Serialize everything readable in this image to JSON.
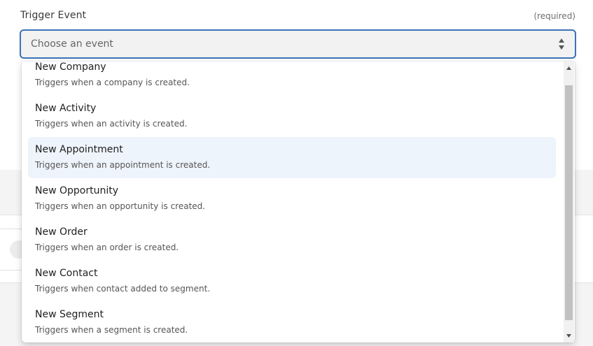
{
  "field": {
    "label": "Trigger Event",
    "required": "(required)"
  },
  "select": {
    "placeholder": "Choose an event"
  },
  "options": [
    {
      "title": "New Company",
      "description": "Triggers when a company is created."
    },
    {
      "title": "New Activity",
      "description": "Triggers when an activity is created."
    },
    {
      "title": "New Appointment",
      "description": "Triggers when an appointment is created."
    },
    {
      "title": "New Opportunity",
      "description": "Triggers when an opportunity is created."
    },
    {
      "title": "New Order",
      "description": "Triggers when an order is created."
    },
    {
      "title": "New Contact",
      "description": "Triggers when contact added to segment."
    },
    {
      "title": "New Segment",
      "description": "Triggers when a segment is created."
    }
  ],
  "highlighted_option": "New Appointment",
  "icons": {
    "select_arrows": "up-down-arrows-icon",
    "scroll_up": "triangle-up-icon",
    "scroll_down": "triangle-down-icon"
  },
  "colors": {
    "focus_border": "#3d72b4",
    "highlight_bg": "#eef4fb",
    "select_bg": "#f2f2f2"
  }
}
